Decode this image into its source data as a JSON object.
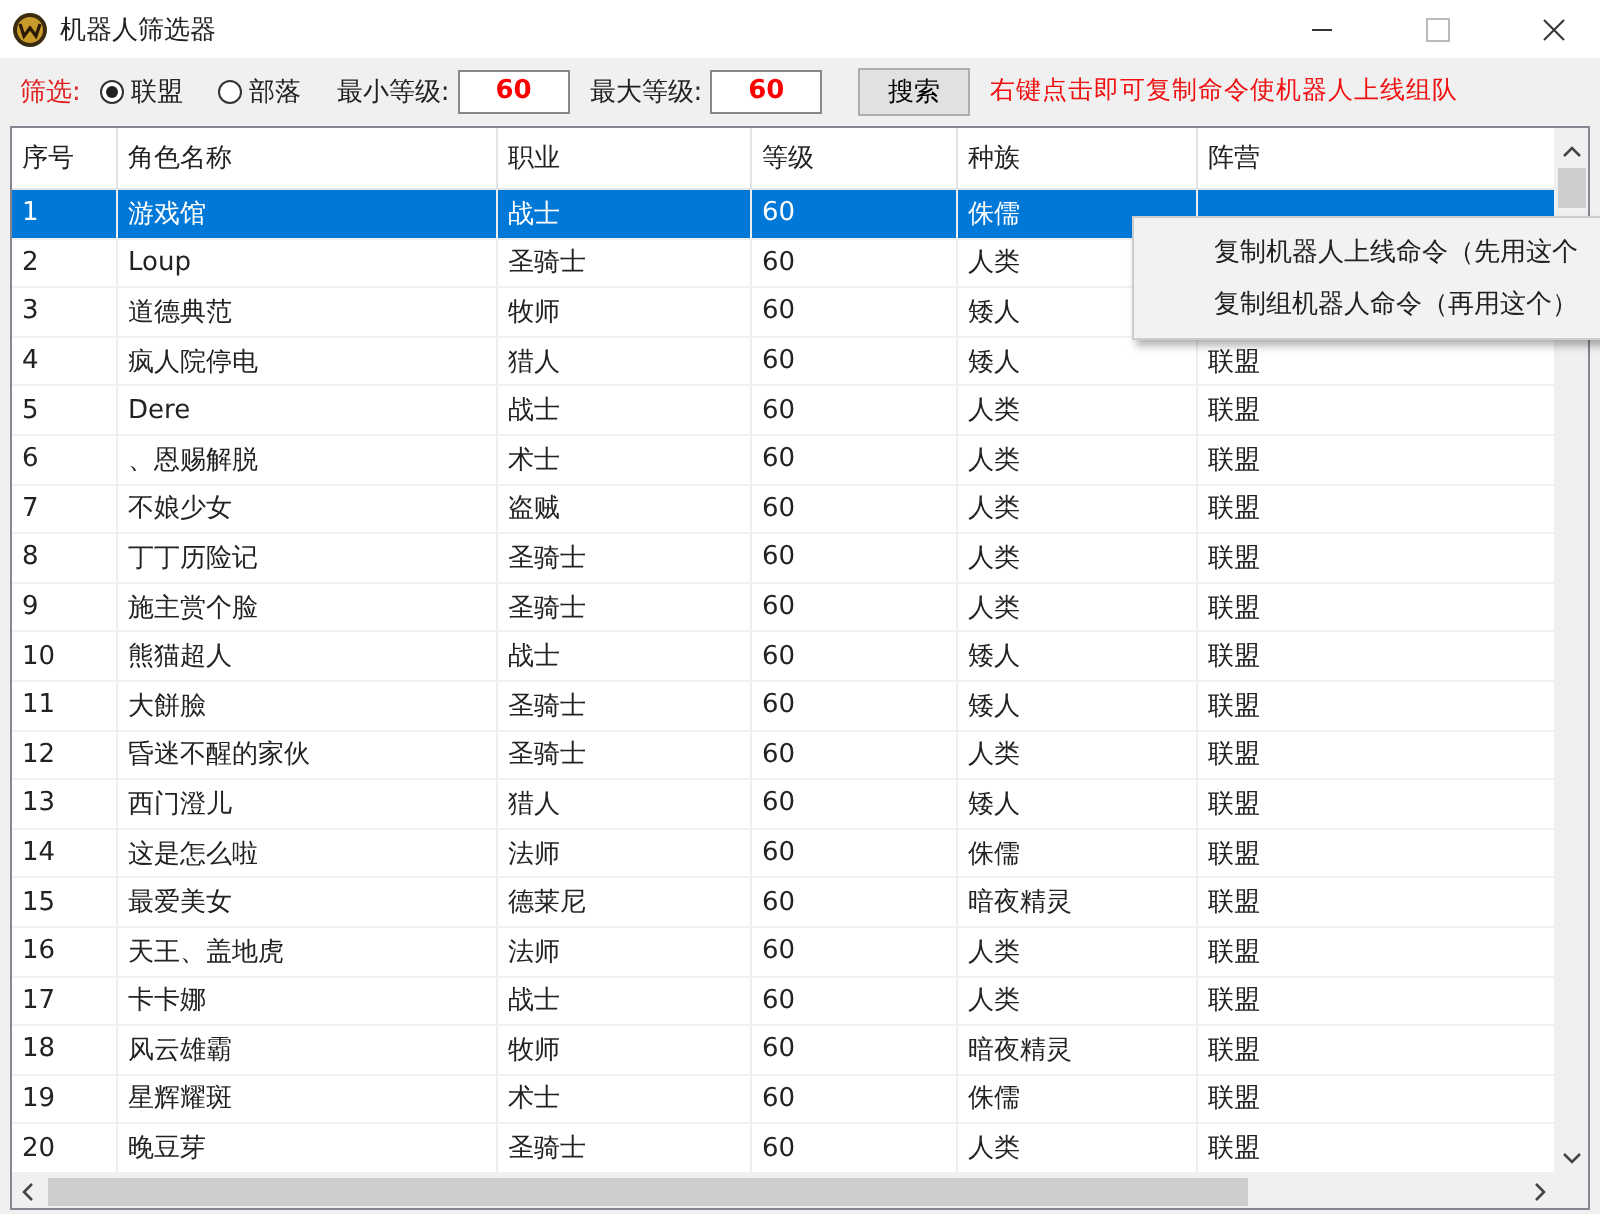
{
  "window": {
    "title": "机器人筛选器"
  },
  "filter": {
    "label": "筛选:",
    "factions": [
      {
        "label": "联盟",
        "selected": true
      },
      {
        "label": "部落",
        "selected": false
      }
    ],
    "min_level": {
      "label": "最小等级:",
      "value": "60"
    },
    "max_level": {
      "label": "最大等级:",
      "value": "60"
    },
    "search_button": "搜索",
    "hint": "右键点击即可复制命令使机器人上线组队"
  },
  "table": {
    "columns": [
      "序号",
      "角色名称",
      "职业",
      "等级",
      "种族",
      "阵营"
    ],
    "rows": [
      {
        "cells": [
          "1",
          "游戏馆",
          "战士",
          "60",
          "侏儒"
        ],
        "selected": true
      },
      {
        "cells": [
          "2",
          "Loup",
          "圣骑士",
          "60",
          "人类"
        ],
        "selected": false
      },
      {
        "cells": [
          "3",
          "道德典范",
          "牧师",
          "60",
          "矮人"
        ],
        "selected": false
      },
      {
        "cells": [
          "4",
          "疯人院停电",
          "猎人",
          "60",
          "矮人",
          "联盟"
        ],
        "selected": false
      },
      {
        "cells": [
          "5",
          "Dere",
          "战士",
          "60",
          "人类",
          "联盟"
        ],
        "selected": false
      },
      {
        "cells": [
          "6",
          "、恩赐解脱",
          "术士",
          "60",
          "人类",
          "联盟"
        ],
        "selected": false
      },
      {
        "cells": [
          "7",
          "不娘少女",
          "盗贼",
          "60",
          "人类",
          "联盟"
        ],
        "selected": false
      },
      {
        "cells": [
          "8",
          "丁丁历险记",
          "圣骑士",
          "60",
          "人类",
          "联盟"
        ],
        "selected": false
      },
      {
        "cells": [
          "9",
          "施主赏个脸",
          "圣骑士",
          "60",
          "人类",
          "联盟"
        ],
        "selected": false
      },
      {
        "cells": [
          "10",
          "熊猫超人",
          "战士",
          "60",
          "矮人",
          "联盟"
        ],
        "selected": false
      },
      {
        "cells": [
          "11",
          "大餅臉",
          "圣骑士",
          "60",
          "矮人",
          "联盟"
        ],
        "selected": false
      },
      {
        "cells": [
          "12",
          "昏迷不醒的家伙",
          "圣骑士",
          "60",
          "人类",
          "联盟"
        ],
        "selected": false
      },
      {
        "cells": [
          "13",
          "西门澄儿",
          "猎人",
          "60",
          "矮人",
          "联盟"
        ],
        "selected": false
      },
      {
        "cells": [
          "14",
          "这是怎么啦",
          "法师",
          "60",
          "侏儒",
          "联盟"
        ],
        "selected": false
      },
      {
        "cells": [
          "15",
          "最爱美女",
          "德莱尼",
          "60",
          "暗夜精灵",
          "联盟"
        ],
        "selected": false
      },
      {
        "cells": [
          "16",
          "天王、盖地虎",
          "法师",
          "60",
          "人类",
          "联盟"
        ],
        "selected": false
      },
      {
        "cells": [
          "17",
          "卡卡娜",
          "战士",
          "60",
          "人类",
          "联盟"
        ],
        "selected": false
      },
      {
        "cells": [
          "18",
          "风云雄霸",
          "牧师",
          "60",
          "暗夜精灵",
          "联盟"
        ],
        "selected": false
      },
      {
        "cells": [
          "19",
          "星辉耀斑",
          "术士",
          "60",
          "侏儒",
          "联盟"
        ],
        "selected": false
      },
      {
        "cells": [
          "20",
          "晚豆芽",
          "圣骑士",
          "60",
          "人类",
          "联盟"
        ],
        "selected": false
      }
    ]
  },
  "context_menu": {
    "items": [
      "复制机器人上线命令（先用这个",
      "复制组机器人命令（再用这个）"
    ]
  }
}
